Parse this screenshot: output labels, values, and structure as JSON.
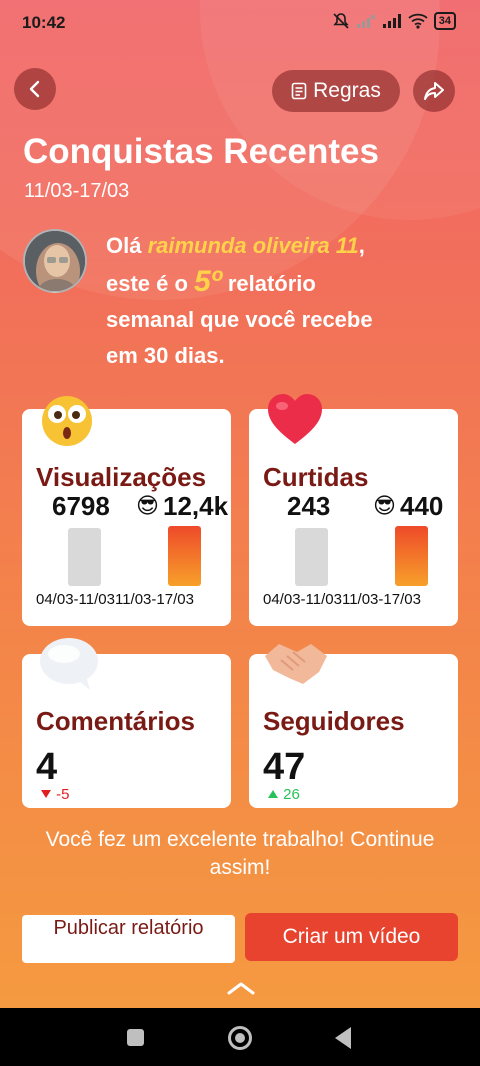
{
  "status": {
    "time": "10:42",
    "battery": "34",
    "icons": [
      "mute-icon",
      "no-signal-icon",
      "signal-icon",
      "wifi-icon",
      "battery-icon"
    ]
  },
  "header": {
    "back_icon": "chevron-left-icon",
    "rules_label": "Regras",
    "rules_icon": "document-icon",
    "share_icon": "share-icon"
  },
  "report": {
    "title": "Conquistas Recentes",
    "date_range": "11/03-17/03"
  },
  "greeting": {
    "prefix": "Olá ",
    "user_name": "raimunda oliveira 11",
    "suffix": ",",
    "line2_prefix": "este é o ",
    "report_number": "5º",
    "line2_suffix": " relatório",
    "line3": "semanal que você recebe",
    "line4": "em 30 dias."
  },
  "cards": {
    "views": {
      "title": "Visualizações",
      "previous": "6798",
      "current": "12,4k",
      "current_emoji": "😎",
      "emoji": "😲",
      "prev_period": "04/03-11/03",
      "curr_period": "11/03-17/03"
    },
    "likes": {
      "title": "Curtidas",
      "previous": "243",
      "current": "440",
      "current_emoji": "😎",
      "emoji": "❤",
      "prev_period": "04/03-11/03",
      "curr_period": "11/03-17/03"
    },
    "comments": {
      "title": "Comentários",
      "value": "4",
      "delta": "-5",
      "delta_direction": "down",
      "emoji": "💬"
    },
    "followers": {
      "title": "Seguidores",
      "value": "47",
      "delta": "26",
      "delta_direction": "up",
      "emoji": "🤝"
    }
  },
  "footer": {
    "message": "Você fez um excelente trabalho! Continue assim!",
    "publish_label": "Publicar relatório",
    "create_label": "Criar um vídeo"
  },
  "colors": {
    "accent": "#e8432f",
    "card_title": "#7a1a14",
    "highlight": "#ffd24a",
    "down": "#e02020",
    "up": "#27c25a"
  }
}
